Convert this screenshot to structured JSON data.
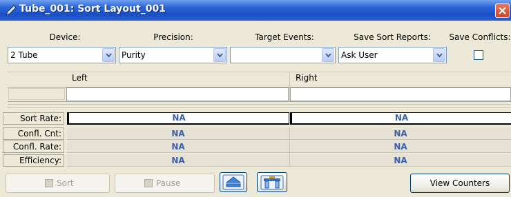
{
  "window": {
    "title": "Tube_001: Sort Layout_001"
  },
  "headers": {
    "device": "Device:",
    "precision": "Precision:",
    "target_events": "Target Events:",
    "save_sort_reports": "Save Sort Reports:",
    "save_conflicts": "Save Conflicts:"
  },
  "fields": {
    "device": "2 Tube",
    "precision": "Purity",
    "target_events": "",
    "save_sort_reports": "Ask User",
    "save_conflicts_checked": false
  },
  "grid": {
    "left_label": "Left",
    "right_label": "Right"
  },
  "stats": {
    "rows": [
      {
        "label": "Sort Rate:",
        "left": "NA",
        "right": "NA"
      },
      {
        "label": "Confl. Cnt:",
        "left": "NA",
        "right": "NA"
      },
      {
        "label": "Confl. Rate:",
        "left": "NA",
        "right": "NA"
      },
      {
        "label": "Efficiency:",
        "left": "NA",
        "right": "NA"
      }
    ]
  },
  "buttons": {
    "sort": "Sort",
    "pause": "Pause",
    "view_counters": "View Counters"
  },
  "icons": {
    "title": "pencil-icon",
    "close": "close-icon",
    "eject": "eject-icon",
    "tube_holder": "tube-holder-icon"
  },
  "colors": {
    "titlebar": "#2c66d8",
    "value_text": "#3a5fa8",
    "close": "#c8462a"
  }
}
